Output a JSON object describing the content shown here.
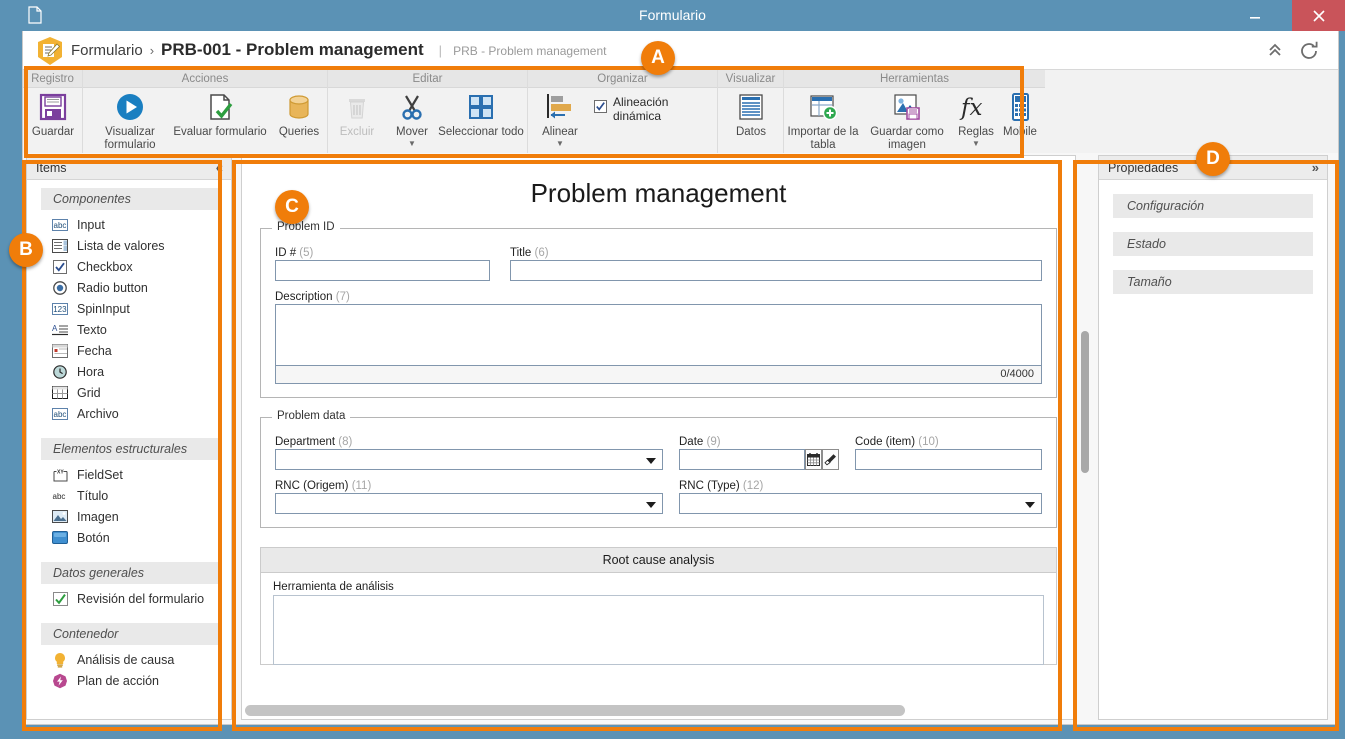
{
  "window": {
    "title": "Formulario",
    "doc_icon": "document-icon",
    "minimize": "minimize-icon",
    "maximize": "maximize-icon",
    "close": "close-icon"
  },
  "header": {
    "logo_icon": "form-logo-icon",
    "breadcrumb_root": "Formulario",
    "breadcrumb_separator": "›",
    "breadcrumb_current": "PRB-001 - Problem management",
    "breadcrumb_pipe": "|",
    "breadcrumb_subtitle": "PRB - Problem management",
    "collapse_icon": "chevron-up-double-icon",
    "refresh_icon": "refresh-icon"
  },
  "ribbon": {
    "groups": [
      {
        "title": "Registro",
        "items": [
          {
            "label": "Guardar",
            "icon": "save-floppy-icon",
            "disabled": false,
            "caret": false
          }
        ]
      },
      {
        "title": "Acciones",
        "items": [
          {
            "label": "Visualizar formulario",
            "icon": "play-circle-icon",
            "disabled": false,
            "caret": false
          },
          {
            "label": "Evaluar formulario",
            "icon": "page-check-icon",
            "disabled": false,
            "caret": false
          },
          {
            "label": "Queries",
            "icon": "database-icon",
            "disabled": false,
            "caret": false
          }
        ]
      },
      {
        "title": "Editar",
        "items": [
          {
            "label": "Excluir",
            "icon": "trash-icon",
            "disabled": true,
            "caret": false
          },
          {
            "label": "Mover",
            "icon": "scissors-icon",
            "disabled": false,
            "caret": true
          },
          {
            "label": "Seleccionar todo",
            "icon": "select-all-icon",
            "disabled": false,
            "caret": false
          }
        ]
      },
      {
        "title": "Organizar",
        "items": [
          {
            "label": "Alinear",
            "icon": "align-left-icon",
            "disabled": false,
            "caret": true
          }
        ],
        "checkbox": {
          "label": "Alineación dinámica",
          "checked": true
        }
      },
      {
        "title": "Visualizar",
        "items": [
          {
            "label": "Datos",
            "icon": "data-lines-icon",
            "disabled": false,
            "caret": false
          }
        ]
      },
      {
        "title": "Herramientas",
        "items": [
          {
            "label": "Importar de la tabla",
            "icon": "import-table-icon",
            "disabled": false,
            "caret": false
          },
          {
            "label": "Guardar como imagen",
            "icon": "save-as-image-icon",
            "disabled": false,
            "caret": false
          },
          {
            "label": "Reglas",
            "icon": "fx-icon",
            "disabled": false,
            "caret": true
          },
          {
            "label": "Mobile",
            "icon": "mobile-icon",
            "disabled": false,
            "caret": false
          }
        ]
      }
    ]
  },
  "items_panel": {
    "title": "Ítems",
    "collapse_icon": "chevron-left-double-icon",
    "sections": [
      {
        "title": "Componentes",
        "items": [
          {
            "label": "Input",
            "icon": "abc-input-icon"
          },
          {
            "label": "Lista de valores",
            "icon": "list-values-icon"
          },
          {
            "label": "Checkbox",
            "icon": "checkbox-icon"
          },
          {
            "label": "Radio button",
            "icon": "radio-button-icon"
          },
          {
            "label": "SpinInput",
            "icon": "spin-input-icon"
          },
          {
            "label": "Texto",
            "icon": "text-icon"
          },
          {
            "label": "Fecha",
            "icon": "date-icon"
          },
          {
            "label": "Hora",
            "icon": "clock-icon"
          },
          {
            "label": "Grid",
            "icon": "grid-icon"
          },
          {
            "label": "Archivo",
            "icon": "file-abc-icon"
          }
        ]
      },
      {
        "title": "Elementos estructurales",
        "items": [
          {
            "label": "FieldSet",
            "icon": "fieldset-icon"
          },
          {
            "label": "Título",
            "icon": "abc-title-icon"
          },
          {
            "label": "Imagen",
            "icon": "image-icon"
          },
          {
            "label": "Botón",
            "icon": "button-icon"
          }
        ]
      },
      {
        "title": "Datos generales",
        "items": [
          {
            "label": "Revisión del formulario",
            "icon": "review-check-icon"
          }
        ]
      },
      {
        "title": "Contenedor",
        "items": [
          {
            "label": "Análisis de causa",
            "icon": "lightbulb-icon"
          },
          {
            "label": "Plan de acción",
            "icon": "action-plan-icon"
          }
        ]
      }
    ]
  },
  "form": {
    "title": "Problem management",
    "fieldsets": [
      {
        "legend": "Problem ID",
        "fields": [
          {
            "label": "ID #",
            "num": "(5)",
            "type": "text"
          },
          {
            "label": "Title",
            "num": "(6)",
            "type": "text"
          },
          {
            "label": "Description",
            "num": "(7)",
            "type": "textarea",
            "counter": "0/4000"
          }
        ]
      },
      {
        "legend": "Problem data",
        "fields": [
          {
            "label": "Department",
            "num": "(8)",
            "type": "select"
          },
          {
            "label": "Date",
            "num": "(9)",
            "type": "date",
            "calendar_icon": "calendar-icon",
            "clear_icon": "eraser-icon"
          },
          {
            "label": "Code (item)",
            "num": "(10)",
            "type": "text"
          },
          {
            "label": "RNC (Origem)",
            "num": "(11)",
            "type": "select"
          },
          {
            "label": "RNC (Type)",
            "num": "(12)",
            "type": "select"
          }
        ]
      }
    ],
    "section": {
      "title": "Root cause analysis",
      "field_label": "Herramienta de análisis"
    }
  },
  "props_panel": {
    "title": "Propiedades",
    "collapse_icon": "chevron-right-double-icon",
    "sections": [
      {
        "label": "Configuración"
      },
      {
        "label": "Estado"
      },
      {
        "label": "Tamaño"
      }
    ]
  },
  "annotations": {
    "accent_color": "#f07d0a",
    "badges": [
      {
        "label": "A"
      },
      {
        "label": "B"
      },
      {
        "label": "C"
      },
      {
        "label": "D"
      }
    ]
  },
  "colors": {
    "titlebar": "#5b92b5",
    "close_button": "#c9545a",
    "accent": "#f07d0a",
    "panel_header": "#ececec"
  }
}
